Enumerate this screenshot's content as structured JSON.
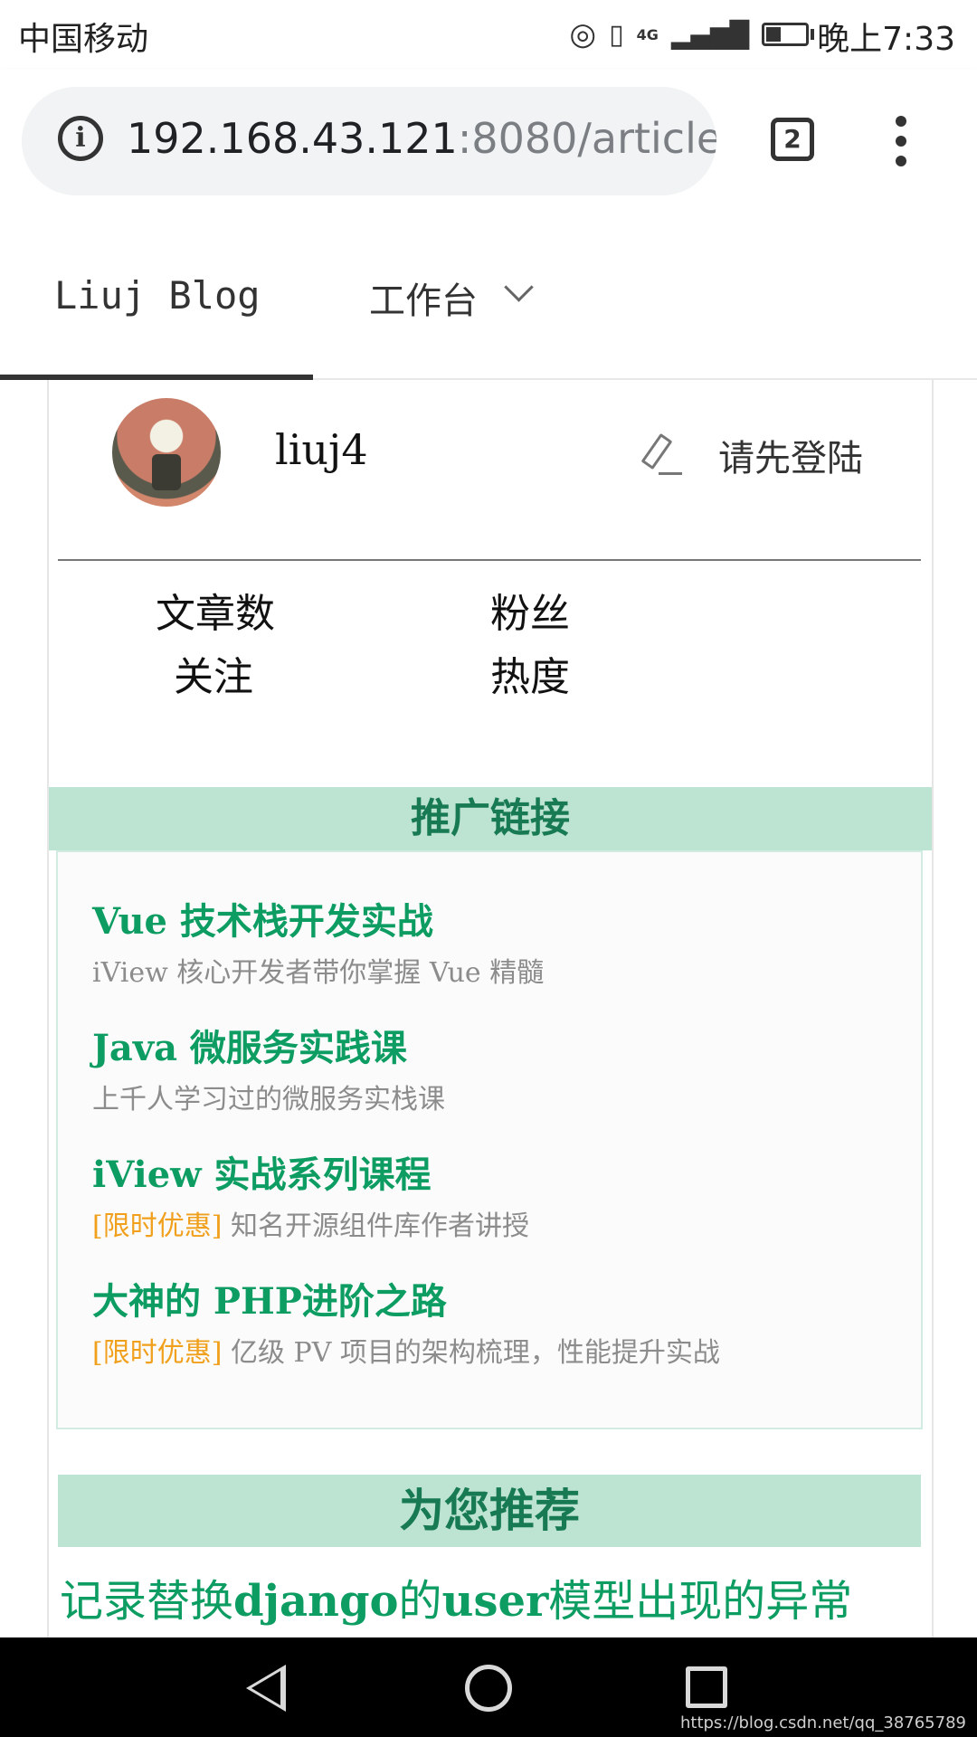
{
  "status_bar": {
    "carrier": "中国移动",
    "network": "4G",
    "time": "晚上7:33"
  },
  "browser": {
    "url_host": "192.168.43.121",
    "url_rest": ":8080/article/",
    "tab_count": "2"
  },
  "site_nav": {
    "brand": "Liuj Blog",
    "workbench": "工作台"
  },
  "profile": {
    "username": "liuj4",
    "login_link": "请先登陆"
  },
  "stats": [
    "文章数",
    "粉丝",
    "关注",
    "热度"
  ],
  "promo": {
    "header": "推广链接",
    "items": [
      {
        "title": "Vue 技术栈开发实战",
        "tag": "",
        "desc": "iView 核心开发者带你掌握 Vue 精髓"
      },
      {
        "title": "Java 微服务实践课",
        "tag": "",
        "desc": "上千人学习过的微服务实栈课"
      },
      {
        "title": "iView 实战系列课程",
        "tag": "[限时优惠]",
        "desc": "知名开源组件库作者讲授"
      },
      {
        "title": "大神的 PHP进阶之路",
        "tag": "[限时优惠]",
        "desc": "亿级 PV 项目的架构梳理，性能提升实战"
      }
    ]
  },
  "recommend": {
    "header": "为您推荐",
    "items": [
      {
        "parts": [
          "记录替换",
          "django",
          "的",
          "user",
          "模型出现的异常"
        ]
      }
    ]
  },
  "watermark": "https://blog.csdn.net/qq_38765789"
}
